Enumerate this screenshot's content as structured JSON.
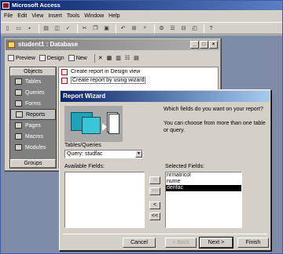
{
  "app": {
    "title": "Microsoft Access",
    "menu": [
      "File",
      "Edit",
      "View",
      "Insert",
      "Tools",
      "Window",
      "Help"
    ]
  },
  "db": {
    "title": "student1 : Database",
    "toolbar": {
      "preview": "Preview",
      "design": "Design",
      "new": "New"
    },
    "objects_header": "Objects",
    "objects": [
      "Tables",
      "Queries",
      "Forms",
      "Reports",
      "Pages",
      "Macros",
      "Modules"
    ],
    "selected_object": "Reports",
    "groups": "Groups",
    "list": [
      "Create report in Design view",
      "Create report by using wizard"
    ]
  },
  "wizard": {
    "title": "Report Wizard",
    "question": "Which fields do you want on your report?",
    "hint": "You can choose from more than one table or query.",
    "tables_label": "Tables/Queries",
    "tables_value": "Query: studfac",
    "available_label": "Available Fields:",
    "selected_label": "Selected Fields:",
    "available_fields": [],
    "selected_fields": [
      "nrmatricol",
      "nume",
      "denfac"
    ],
    "selected_highlight": "denfac",
    "move_buttons": [
      ">",
      ">>",
      "<",
      "<<"
    ],
    "buttons": {
      "cancel": "Cancel",
      "back": "< Back",
      "next": "Next >",
      "finish": "Finish"
    }
  }
}
